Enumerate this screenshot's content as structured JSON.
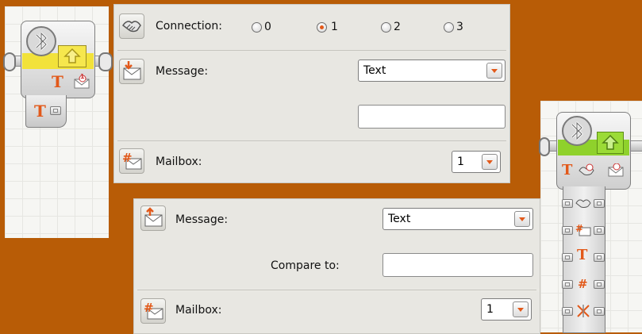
{
  "send_panel": {
    "connection": {
      "label": "Connection:",
      "options": [
        "0",
        "1",
        "2",
        "3"
      ],
      "selected": "1"
    },
    "message": {
      "label": "Message:",
      "type_value": "Text",
      "text_value": ""
    },
    "mailbox": {
      "label": "Mailbox:",
      "value": "1"
    }
  },
  "receive_panel": {
    "message": {
      "label": "Message:",
      "type_value": "Text"
    },
    "compare": {
      "label": "Compare to:",
      "value": ""
    },
    "mailbox": {
      "label": "Mailbox:",
      "value": "1"
    }
  },
  "blocks": {
    "send_block_icon": "bluetooth-send-icon",
    "receive_block_icon": "bluetooth-receive-icon",
    "text_plug_glyph": "T",
    "number_badge": "1"
  },
  "colors": {
    "background": "#b85c06",
    "send_block_accent": "#f2e23a",
    "receive_block_accent": "#8fd12c",
    "selection_accent": "#e2591a"
  }
}
